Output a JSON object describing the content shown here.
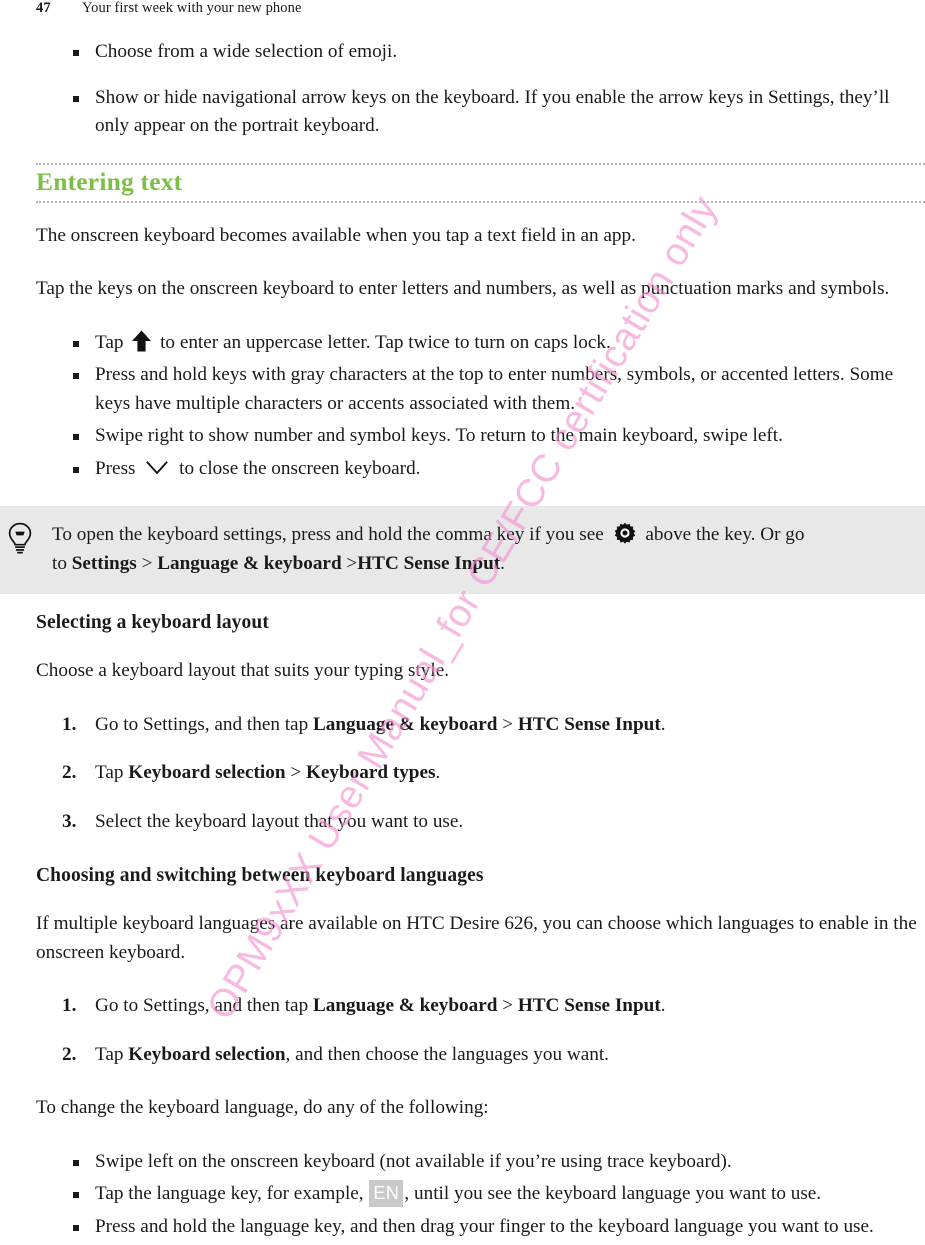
{
  "header": {
    "page_number": "47",
    "chapter_title": "Your first week with your new phone"
  },
  "watermark": {
    "text": "OPM9xXX User Manual_for CE/FCC certification only",
    "color": "#f48fd0"
  },
  "top_bullets": {
    "items": [
      {
        "text": "Choose from a wide selection of emoji."
      },
      {
        "text": "Show or hide navigational arrow keys on the keyboard. If you enable the arrow keys in Settings, they’ll only appear on the portrait keyboard."
      }
    ]
  },
  "section": {
    "heading": "Entering text",
    "heading_color": "#7cbf45",
    "intro_paragraph_1": "The onscreen keyboard becomes available when you tap a text field in an app.",
    "intro_paragraph_2": "Tap the keys on the onscreen keyboard to enter letters and numbers, as well as punctuation marks and symbols."
  },
  "keyboard_bullets": {
    "item_1_pre": "Tap",
    "item_1_icon": "shift-up-arrow-icon",
    "item_1_post": "to enter an uppercase letter. Tap twice to turn on caps lock.",
    "item_2": "Press and hold keys with gray characters at the top to enter numbers, symbols, or accented letters. Some keys have multiple characters or accents associated with them.",
    "item_3": "Swipe right to show number and symbol keys. To return to the main keyboard, swipe left.",
    "item_4_pre": "Press",
    "item_4_icon": "chevron-down-icon",
    "item_4_post": "to close the onscreen keyboard."
  },
  "tip": {
    "icon": "lightbulb-icon",
    "line1_part1": "To open the keyboard settings, press and hold the comma key if you see",
    "gear_icon": "gear-settings-icon",
    "line1_part2": "above the key. Or go",
    "line2_part1": "to",
    "line2_bold1": "Settings",
    "line2_sep1": ">",
    "line2_bold2": "Language & keyboard",
    "line2_sep2": ">",
    "line2_bold3": "HTC Sense Input",
    "line2_end": "."
  },
  "layout_section": {
    "heading": "Selecting a keyboard layout",
    "intro": "Choose a keyboard layout that suits your typing style.",
    "steps": [
      {
        "pre": "Go to Settings, and then tap ",
        "bold1": "Language & keyboard",
        "sep": " > ",
        "bold2": "HTC Sense Input",
        "post": "."
      },
      {
        "pre": "Tap ",
        "bold1": "Keyboard selection",
        "sep": " > ",
        "bold2": "Keyboard types",
        "post": "."
      },
      {
        "pre": "Select the keyboard layout that you want to use.",
        "bold1": "",
        "sep": "",
        "bold2": "",
        "post": ""
      }
    ]
  },
  "languages_section": {
    "heading": "Choosing and switching between keyboard languages",
    "intro": "If multiple keyboard languages are available on HTC Desire 626, you can choose which languages to enable in the onscreen keyboard.",
    "steps": [
      {
        "pre": "Go to Settings, and then tap ",
        "bold1": "Language & keyboard",
        "sep": " > ",
        "bold2": "HTC Sense Input",
        "post": "."
      },
      {
        "pre": "Tap ",
        "bold1": "Keyboard selection",
        "sep": "",
        "bold2": "",
        "post": ", and then choose the languages you want."
      }
    ],
    "change_intro": "To change the keyboard language, do any of the following:",
    "change_bullets": {
      "item_1": "Swipe left on the onscreen keyboard (not available if you’re using trace keyboard).",
      "item_2_pre": "Tap the language key, for example,",
      "item_2_key": "EN",
      "item_2_post": ", until you see the keyboard language you want to use.",
      "item_3": "Press and hold the language key, and then drag your finger to the keyboard language you want to use."
    }
  }
}
